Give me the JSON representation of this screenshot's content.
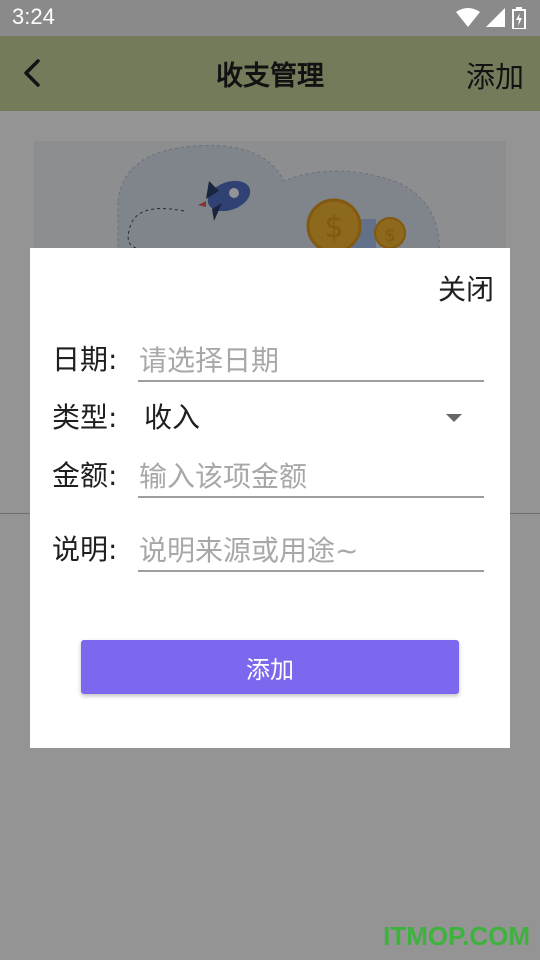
{
  "status_bar": {
    "time": "3:24"
  },
  "app_bar": {
    "title": "收支管理",
    "add_label": "添加"
  },
  "dialog": {
    "close_label": "关闭",
    "fields": {
      "date": {
        "label": "日期:",
        "placeholder": "请选择日期"
      },
      "type": {
        "label": "类型:",
        "value": "收入"
      },
      "amount": {
        "label": "金额:",
        "placeholder": "输入该项金额"
      },
      "note": {
        "label": "说明:",
        "placeholder": "说明来源或用途~"
      }
    },
    "submit_label": "添加"
  },
  "watermark": "ITMOP.COM",
  "colors": {
    "app_bar": "#c6d59d",
    "accent": "#7b68ee",
    "watermark": "#3db33d"
  },
  "icons": [
    "wifi-icon",
    "signal-icon",
    "battery-icon",
    "back-arrow-icon",
    "rocket-icon",
    "coin-icon",
    "dropdown-arrow-icon"
  ]
}
